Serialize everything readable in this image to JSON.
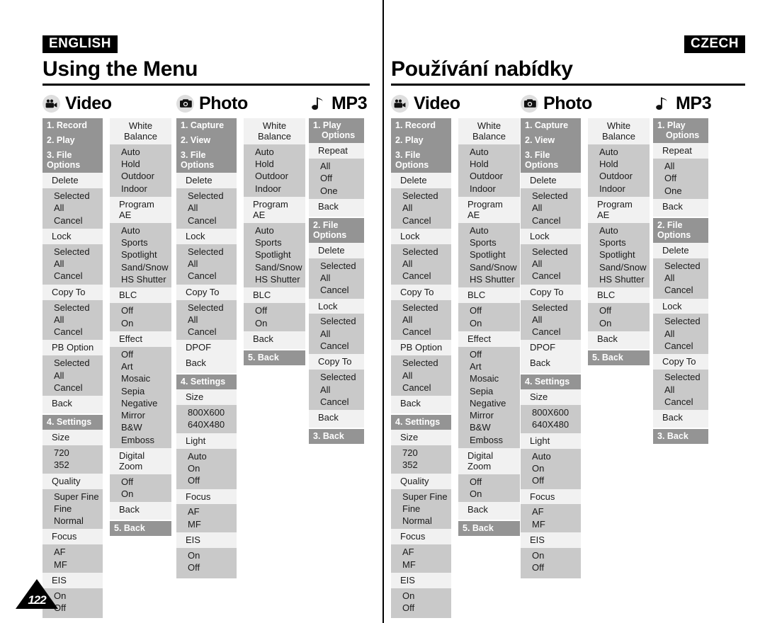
{
  "page": {
    "number": "122",
    "icons": {
      "video": "video-camera-icon",
      "photo": "camera-icon",
      "mp3": "music-note-icon"
    }
  },
  "halves": [
    {
      "id": "english",
      "language_badge": "ENGLISH",
      "title": "Using the Menu",
      "badge_align": "left"
    },
    {
      "id": "czech",
      "language_badge": "CZECH",
      "title": "Používání nabídky",
      "badge_align": "right"
    }
  ],
  "sections": {
    "video": {
      "heading": "Video",
      "col1": [
        {
          "type": "bar",
          "text": "1. Record"
        },
        {
          "type": "bar",
          "text": "2. Play"
        },
        {
          "type": "bar",
          "text": "3. File Options"
        },
        {
          "type": "label",
          "text": "Delete"
        },
        {
          "type": "opts",
          "items": [
            "Selected",
            "All",
            "Cancel"
          ]
        },
        {
          "type": "label",
          "text": "Lock"
        },
        {
          "type": "opts",
          "items": [
            "Selected",
            "All",
            "Cancel"
          ]
        },
        {
          "type": "label",
          "text": "Copy To"
        },
        {
          "type": "opts",
          "items": [
            "Selected",
            "All",
            "Cancel"
          ]
        },
        {
          "type": "label",
          "text": "PB Option"
        },
        {
          "type": "opts",
          "items": [
            "Selected",
            "All",
            "Cancel"
          ]
        },
        {
          "type": "label",
          "text": "Back"
        },
        {
          "type": "bar",
          "text": "4. Settings"
        },
        {
          "type": "label",
          "text": "Size"
        },
        {
          "type": "opts",
          "items": [
            "720",
            "352"
          ]
        },
        {
          "type": "label",
          "text": "Quality"
        },
        {
          "type": "opts",
          "items": [
            "Super Fine",
            "Fine",
            "Normal"
          ]
        },
        {
          "type": "label",
          "text": "Focus"
        },
        {
          "type": "opts",
          "items": [
            "AF",
            "MF"
          ]
        },
        {
          "type": "label",
          "text": "EIS"
        },
        {
          "type": "opts",
          "items": [
            "On",
            "Off"
          ]
        }
      ],
      "col2": [
        {
          "type": "label",
          "text": "White Balance",
          "center": true
        },
        {
          "type": "opts",
          "items": [
            "Auto",
            "Hold",
            "Outdoor",
            "Indoor"
          ]
        },
        {
          "type": "label",
          "text": "Program AE"
        },
        {
          "type": "opts",
          "items": [
            "Auto",
            "Sports",
            "Spotlight",
            "Sand/Snow",
            "HS Shutter"
          ]
        },
        {
          "type": "label",
          "text": "BLC"
        },
        {
          "type": "opts",
          "items": [
            "Off",
            "On"
          ]
        },
        {
          "type": "label",
          "text": "Effect"
        },
        {
          "type": "opts",
          "items": [
            "Off",
            "Art",
            "Mosaic",
            "Sepia",
            "Negative",
            "Mirror",
            "B&W",
            "Emboss"
          ]
        },
        {
          "type": "label",
          "text": "Digital Zoom"
        },
        {
          "type": "opts",
          "items": [
            "Off",
            "On"
          ]
        },
        {
          "type": "label",
          "text": "Back"
        },
        {
          "type": "bar",
          "text": "5. Back"
        }
      ]
    },
    "photo": {
      "heading": "Photo",
      "col1": [
        {
          "type": "bar",
          "text": "1. Capture"
        },
        {
          "type": "bar",
          "text": "2. View"
        },
        {
          "type": "bar",
          "text": "3. File Options"
        },
        {
          "type": "label",
          "text": "Delete"
        },
        {
          "type": "opts",
          "items": [
            "Selected",
            "All",
            "Cancel"
          ]
        },
        {
          "type": "label",
          "text": "Lock"
        },
        {
          "type": "opts",
          "items": [
            "Selected",
            "All",
            "Cancel"
          ]
        },
        {
          "type": "label",
          "text": "Copy To"
        },
        {
          "type": "opts",
          "items": [
            "Selected",
            "All",
            "Cancel"
          ]
        },
        {
          "type": "label",
          "text": "DPOF"
        },
        {
          "type": "label",
          "text": "Back"
        },
        {
          "type": "bar",
          "text": "4. Settings"
        },
        {
          "type": "label",
          "text": "Size"
        },
        {
          "type": "opts",
          "items": [
            "800X600",
            "640X480"
          ]
        },
        {
          "type": "label",
          "text": "Light"
        },
        {
          "type": "opts",
          "items": [
            "Auto",
            "On",
            "Off"
          ]
        },
        {
          "type": "label",
          "text": "Focus"
        },
        {
          "type": "opts",
          "items": [
            "AF",
            "MF"
          ]
        },
        {
          "type": "label",
          "text": "EIS"
        },
        {
          "type": "opts",
          "items": [
            "On",
            "Off"
          ]
        }
      ],
      "col2": [
        {
          "type": "label",
          "text": "White Balance",
          "center": true
        },
        {
          "type": "opts",
          "items": [
            "Auto",
            "Hold",
            "Outdoor",
            "Indoor"
          ]
        },
        {
          "type": "label",
          "text": "Program AE"
        },
        {
          "type": "opts",
          "items": [
            "Auto",
            "Sports",
            "Spotlight",
            "Sand/Snow",
            "HS Shutter"
          ]
        },
        {
          "type": "label",
          "text": "BLC"
        },
        {
          "type": "opts",
          "items": [
            "Off",
            "On"
          ]
        },
        {
          "type": "label",
          "text": "Back"
        },
        {
          "type": "bar",
          "text": "5. Back"
        }
      ]
    },
    "mp3": {
      "heading": "MP3",
      "col1": [
        {
          "type": "bar",
          "text": "1. Play",
          "text2": "Options"
        },
        {
          "type": "label",
          "text": "Repeat"
        },
        {
          "type": "opts",
          "items": [
            "All",
            "Off",
            "One"
          ]
        },
        {
          "type": "label",
          "text": "Back"
        },
        {
          "type": "bar",
          "text": "2. File Options"
        },
        {
          "type": "label",
          "text": "Delete"
        },
        {
          "type": "opts",
          "items": [
            "Selected",
            "All",
            "Cancel"
          ]
        },
        {
          "type": "label",
          "text": "Lock"
        },
        {
          "type": "opts",
          "items": [
            "Selected",
            "All",
            "Cancel"
          ]
        },
        {
          "type": "label",
          "text": "Copy To"
        },
        {
          "type": "opts",
          "items": [
            "Selected",
            "All",
            "Cancel"
          ]
        },
        {
          "type": "label",
          "text": "Back"
        },
        {
          "type": "bar",
          "text": "3. Back"
        }
      ]
    }
  },
  "colors": {
    "bar": "#949494",
    "group_bg": "#f1f1f1",
    "options_bg": "#c9c9c9",
    "badge_bg": "#000000",
    "icon_circle": "#dedede"
  }
}
